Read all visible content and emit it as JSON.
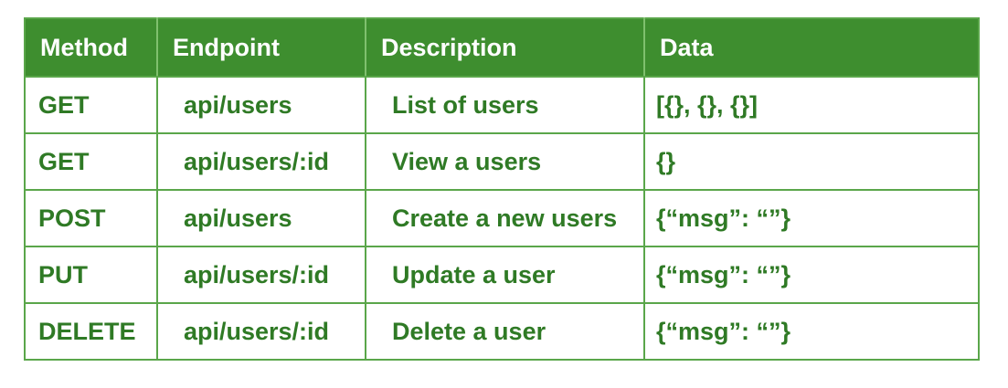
{
  "headers": {
    "method": "Method",
    "endpoint": "Endpoint",
    "description": "Description",
    "data": "Data"
  },
  "rows": [
    {
      "method": "GET",
      "endpoint": "api/users",
      "description": "List of users",
      "data": "[{}, {}, {}]"
    },
    {
      "method": "GET",
      "endpoint": "api/users/:id",
      "description": "View a users",
      "data": "{}"
    },
    {
      "method": "POST",
      "endpoint": "api/users",
      "description": "Create a new users",
      "data": "{“msg”: “”}"
    },
    {
      "method": "PUT",
      "endpoint": "api/users/:id",
      "description": "Update a user",
      "data": "{“msg”: “”}"
    },
    {
      "method": "DELETE",
      "endpoint": "api/users/:id",
      "description": "Delete a user",
      "data": "{“msg”: “”}"
    }
  ],
  "colors": {
    "header_bg": "#3e8e2f",
    "header_text": "#ffffff",
    "cell_text": "#2f7a25",
    "border": "#5aa64a"
  }
}
